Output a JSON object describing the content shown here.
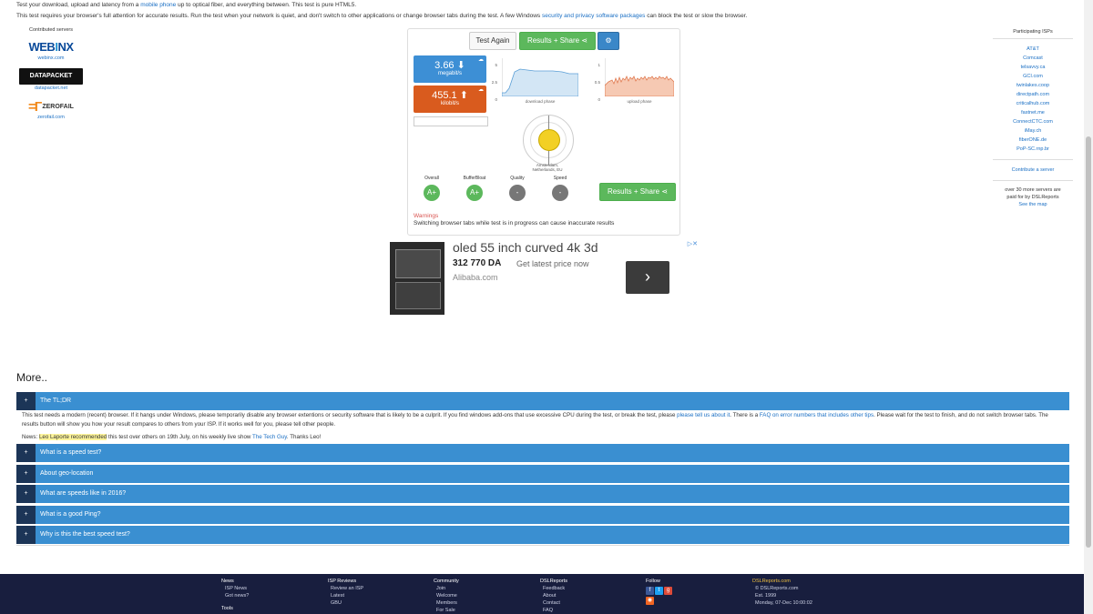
{
  "intro": {
    "line1_a": "Test your download, upload and latency from a",
    "line1_link": "mobile phone",
    "line1_b": "up to optical fiber, and everything between. This test is pure HTML5.",
    "line2_a": "This test requires your browser's full attention for accurate results. Run the test when your network is quiet, and don't switch to other applications or change browser tabs during the test. A few Windows",
    "line2_link": "security and privacy software packages",
    "line2_b": "can block the test or slow the browser."
  },
  "contributed": {
    "header": "Contributed servers",
    "servers": [
      {
        "logo_text": "WEBINX",
        "link": "webinx.com"
      },
      {
        "logo_text": "DATAPACKET",
        "link": "datapacket.net"
      },
      {
        "logo_text": "ZEROFAIL",
        "link": "zerofail.com"
      }
    ]
  },
  "isps": {
    "header": "Participating ISPs",
    "items": [
      "AT&T",
      "Comcast",
      "telsavvy.ca",
      "GCI.com",
      "twinlakes.coop",
      "directpath.com",
      "criticalhub.com",
      "fastnet.me",
      "ConnectCTC.com",
      "iMay.ch",
      "fiberONE.de",
      "PoP-SC.rnp.br"
    ],
    "contribute": "Contribute a server",
    "note_1": "over 30 more servers are",
    "note_2": "paid for by DSLReports",
    "map_link": "See the map"
  },
  "test": {
    "test_again": "Test Again",
    "results_share": "Results + Share",
    "download_value": "3.66",
    "download_unit": "megabit/s",
    "upload_value": "455.1",
    "upload_unit": "kilobit/s",
    "dl_axis": [
      "5",
      "2.5",
      "0"
    ],
    "ul_axis": [
      "1",
      "0.5",
      "0"
    ],
    "dl_caption": "download phase",
    "ul_caption": "upload phase",
    "location_1": "Amsterdam,",
    "location_2": "Netherlands, EU",
    "grades": [
      {
        "label": "Overall",
        "value": "A+"
      },
      {
        "label": "BufferBloat",
        "value": "A+"
      },
      {
        "label": "Quality",
        "value": "-"
      },
      {
        "label": "Speed",
        "value": "-"
      }
    ],
    "warnings_title": "Warnings",
    "warnings_text": "Switching browser tabs while test is in progress can cause inaccurate results"
  },
  "ad": {
    "title": "oled 55 inch curved 4k 3d",
    "price": "312 770 DA",
    "cta": "Get latest price now",
    "source": "Alibaba.com",
    "arrow": "›"
  },
  "more": {
    "heading": "More..",
    "plus": "+",
    "sections": [
      "The TL;DR",
      "What is a speed test?",
      "About geo-location",
      "What are speeds like in 2016?",
      "What is a good Ping?",
      "Why is this the best speed test?"
    ],
    "tldr_a": "This test needs a modern (recent) browser. If it hangs under Windows, please temporarily disable any browser extentions or security software that is likely to be a culprit. If you find windows add-ons that use excessive CPU during the test, or break the test, please",
    "tldr_link1": "please tell us about it",
    "tldr_b": ". There is a",
    "tldr_link2": "FAQ on error numbers that includes other tips",
    "tldr_c": ". Please wait for the test to finish, and do not switch browser tabs. The results button will show you how your result compares to others from your ISP. If it works well for you, please tell other people.",
    "news_a": "News:",
    "news_hl": "Leo Laporte recommended",
    "news_b": "this test over others on 19th July, on his weekly live show",
    "news_link": "The Tech Guy",
    "news_c": ". Thanks Leo!"
  },
  "footer": {
    "news": {
      "h": "News",
      "items": [
        "ISP News",
        "Got news?"
      ],
      "extra": "Tools"
    },
    "reviews": {
      "h": "ISP Reviews",
      "items": [
        "Review an ISP",
        "Latest",
        "GBU"
      ]
    },
    "community": {
      "h": "Community",
      "items": [
        "Join",
        "Welcome",
        "Members",
        "For Sale"
      ]
    },
    "dsl": {
      "h": "DSLReports",
      "items": [
        "Feedback",
        "About",
        "Contact",
        "FAQ"
      ]
    },
    "follow": {
      "h": "Follow"
    },
    "site": {
      "h": "DSLReports.com",
      "items": [
        "© DSLReports.com",
        "Est. 1999",
        "Monday, 07-Dec 10:00:02"
      ]
    }
  }
}
